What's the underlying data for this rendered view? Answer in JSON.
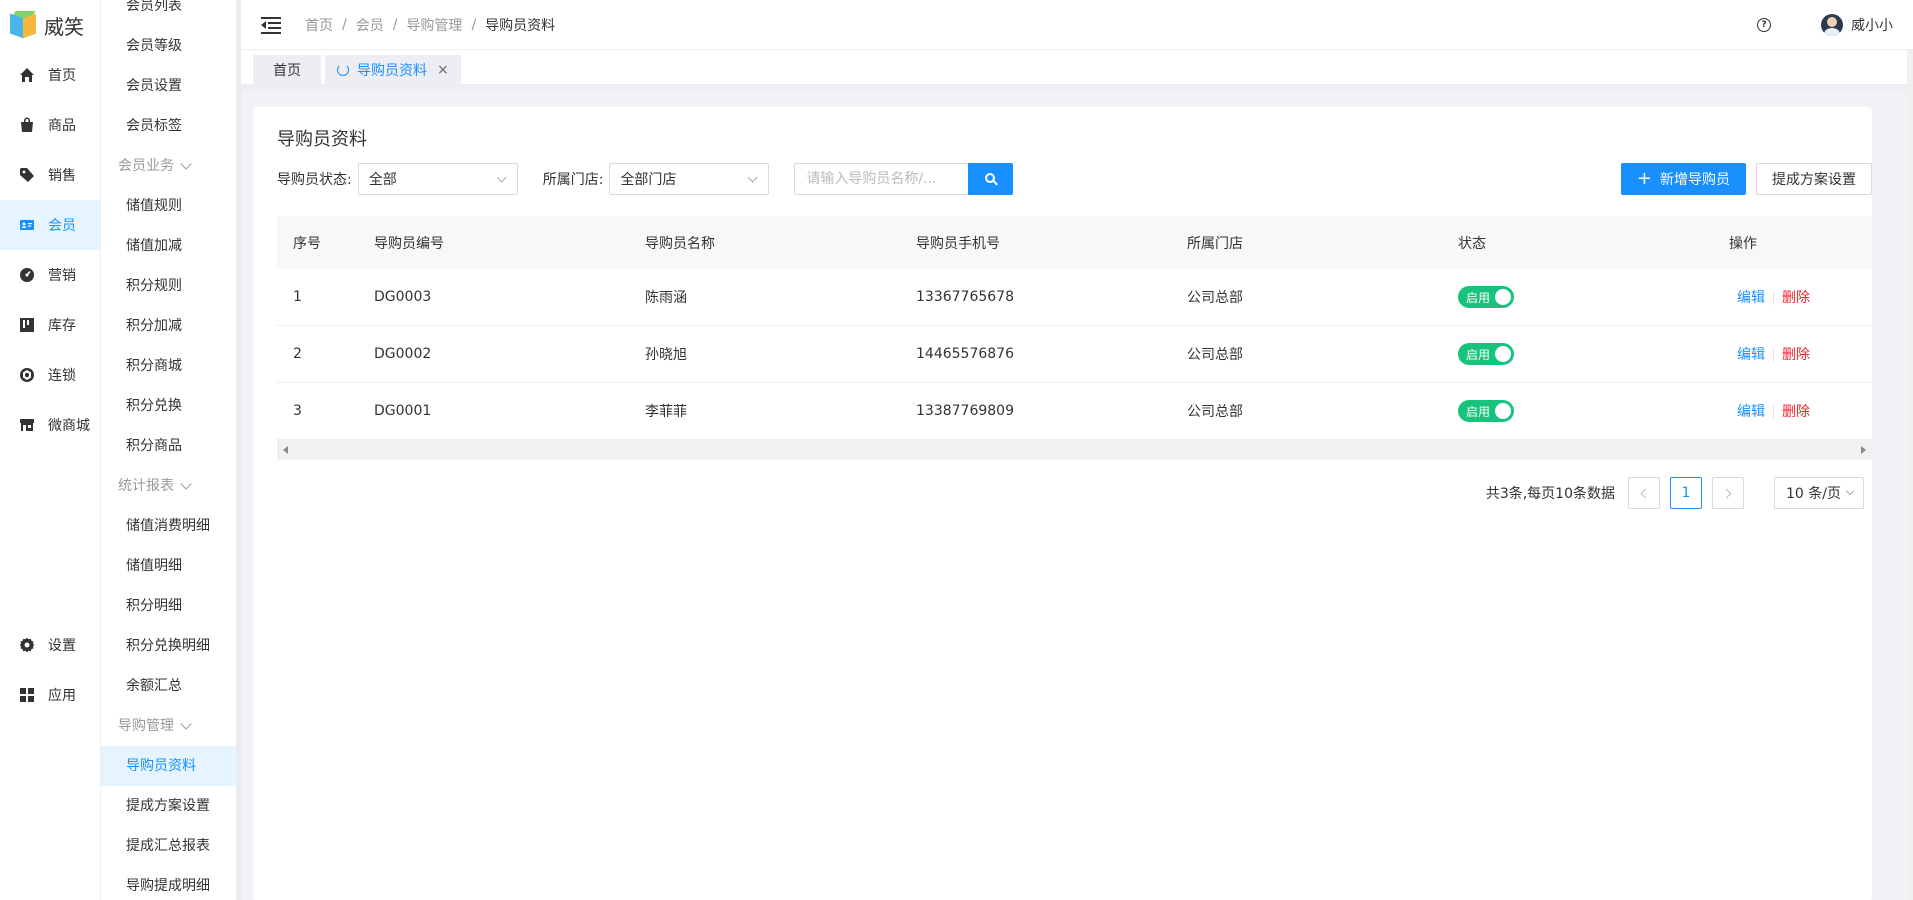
{
  "app": {
    "logo_text": "威笑"
  },
  "rail": {
    "items": [
      {
        "label": "首页",
        "icon": "home-icon"
      },
      {
        "label": "商品",
        "icon": "bag-icon"
      },
      {
        "label": "销售",
        "icon": "tag-icon"
      },
      {
        "label": "会员",
        "icon": "member-card-icon",
        "active": true
      },
      {
        "label": "营销",
        "icon": "dashboard-icon"
      },
      {
        "label": "库存",
        "icon": "stock-icon"
      },
      {
        "label": "连锁",
        "icon": "chain-icon"
      },
      {
        "label": "微商城",
        "icon": "shop-icon"
      }
    ],
    "bottom": [
      {
        "label": "设置",
        "icon": "gear-icon"
      },
      {
        "label": "应用",
        "icon": "apps-icon"
      }
    ]
  },
  "submenu": {
    "items": [
      {
        "type": "item",
        "label": "会员列表"
      },
      {
        "type": "item",
        "label": "会员等级"
      },
      {
        "type": "item",
        "label": "会员设置"
      },
      {
        "type": "item",
        "label": "会员标签"
      },
      {
        "type": "group",
        "label": "会员业务"
      },
      {
        "type": "item",
        "label": "储值规则"
      },
      {
        "type": "item",
        "label": "储值加减"
      },
      {
        "type": "item",
        "label": "积分规则"
      },
      {
        "type": "item",
        "label": "积分加减"
      },
      {
        "type": "item",
        "label": "积分商城"
      },
      {
        "type": "item",
        "label": "积分兑换"
      },
      {
        "type": "item",
        "label": "积分商品"
      },
      {
        "type": "group",
        "label": "统计报表"
      },
      {
        "type": "item",
        "label": "储值消费明细"
      },
      {
        "type": "item",
        "label": "储值明细"
      },
      {
        "type": "item",
        "label": "积分明细"
      },
      {
        "type": "item",
        "label": "积分兑换明细"
      },
      {
        "type": "item",
        "label": "余额汇总"
      },
      {
        "type": "group",
        "label": "导购管理"
      },
      {
        "type": "item",
        "label": "导购员资料",
        "active": true
      },
      {
        "type": "item",
        "label": "提成方案设置"
      },
      {
        "type": "item",
        "label": "提成汇总报表"
      },
      {
        "type": "item",
        "label": "导购提成明细"
      }
    ]
  },
  "header": {
    "breadcrumb": [
      "首页",
      "会员",
      "导购管理",
      "导购员资料"
    ],
    "username": "威小小"
  },
  "tabs": [
    {
      "label": "首页",
      "active": false
    },
    {
      "label": "导购员资料",
      "active": true
    }
  ],
  "page": {
    "title": "导购员资料",
    "filters": {
      "status_label": "导购员状态:",
      "status_value": "全部",
      "store_label": "所属门店:",
      "store_value": "全部门店",
      "search_placeholder": "请输入导购员名称/..."
    },
    "actions": {
      "add_label": "新增导购员",
      "commission_label": "提成方案设置"
    },
    "table": {
      "columns": [
        "序号",
        "导购员编号",
        "导购员名称",
        "导购员手机号",
        "所属门店",
        "状态",
        "操作"
      ],
      "rows": [
        {
          "no": "1",
          "code": "DG0003",
          "name": "陈雨涵",
          "phone": "13367765678",
          "store": "公司总部",
          "status": "启用"
        },
        {
          "no": "2",
          "code": "DG0002",
          "name": "孙晓旭",
          "phone": "14465576876",
          "store": "公司总部",
          "status": "启用"
        },
        {
          "no": "3",
          "code": "DG0001",
          "name": "李菲菲",
          "phone": "13387769809",
          "store": "公司总部",
          "status": "启用"
        }
      ],
      "edit_label": "编辑",
      "delete_label": "删除"
    },
    "pagination": {
      "total_text": "共3条,每页10条数据",
      "current_page": "1",
      "page_size": "10 条/页"
    }
  },
  "colors": {
    "accent": "#1890ff",
    "toggle_on": "#19c37d",
    "danger": "#f5222d"
  }
}
